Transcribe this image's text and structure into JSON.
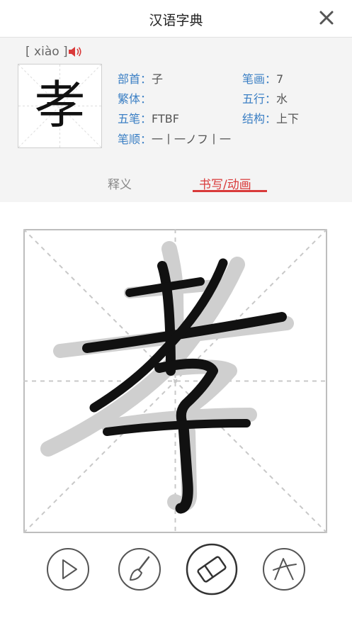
{
  "header": {
    "title": "汉语字典",
    "close_icon": "close-icon"
  },
  "entry": {
    "pinyin": "[ xiào ]",
    "character": "孝",
    "fields": {
      "radical_label": "部首：",
      "radical_value": "子",
      "strokes_label": "笔画：",
      "strokes_value": "7",
      "traditional_label": "繁体：",
      "traditional_value": "",
      "wuxing_label": "五行：",
      "wuxing_value": "水",
      "wubi_label": "五笔：",
      "wubi_value": "FTBF",
      "structure_label": "结构：",
      "structure_value": "上下",
      "order_label": "笔顺：",
      "order_value": "一丨一ノフ丨一"
    }
  },
  "tabs": [
    {
      "label": "释义",
      "active": false
    },
    {
      "label": "书写/动画",
      "active": true
    }
  ],
  "controls": [
    {
      "icon": "play-icon"
    },
    {
      "icon": "brush-icon"
    },
    {
      "icon": "eraser-icon"
    },
    {
      "icon": "stroke-order-icon"
    }
  ],
  "colors": {
    "accent_red": "#d93a3a",
    "label_blue": "#3b7fc4",
    "panel_bg": "#f4f4f4"
  }
}
